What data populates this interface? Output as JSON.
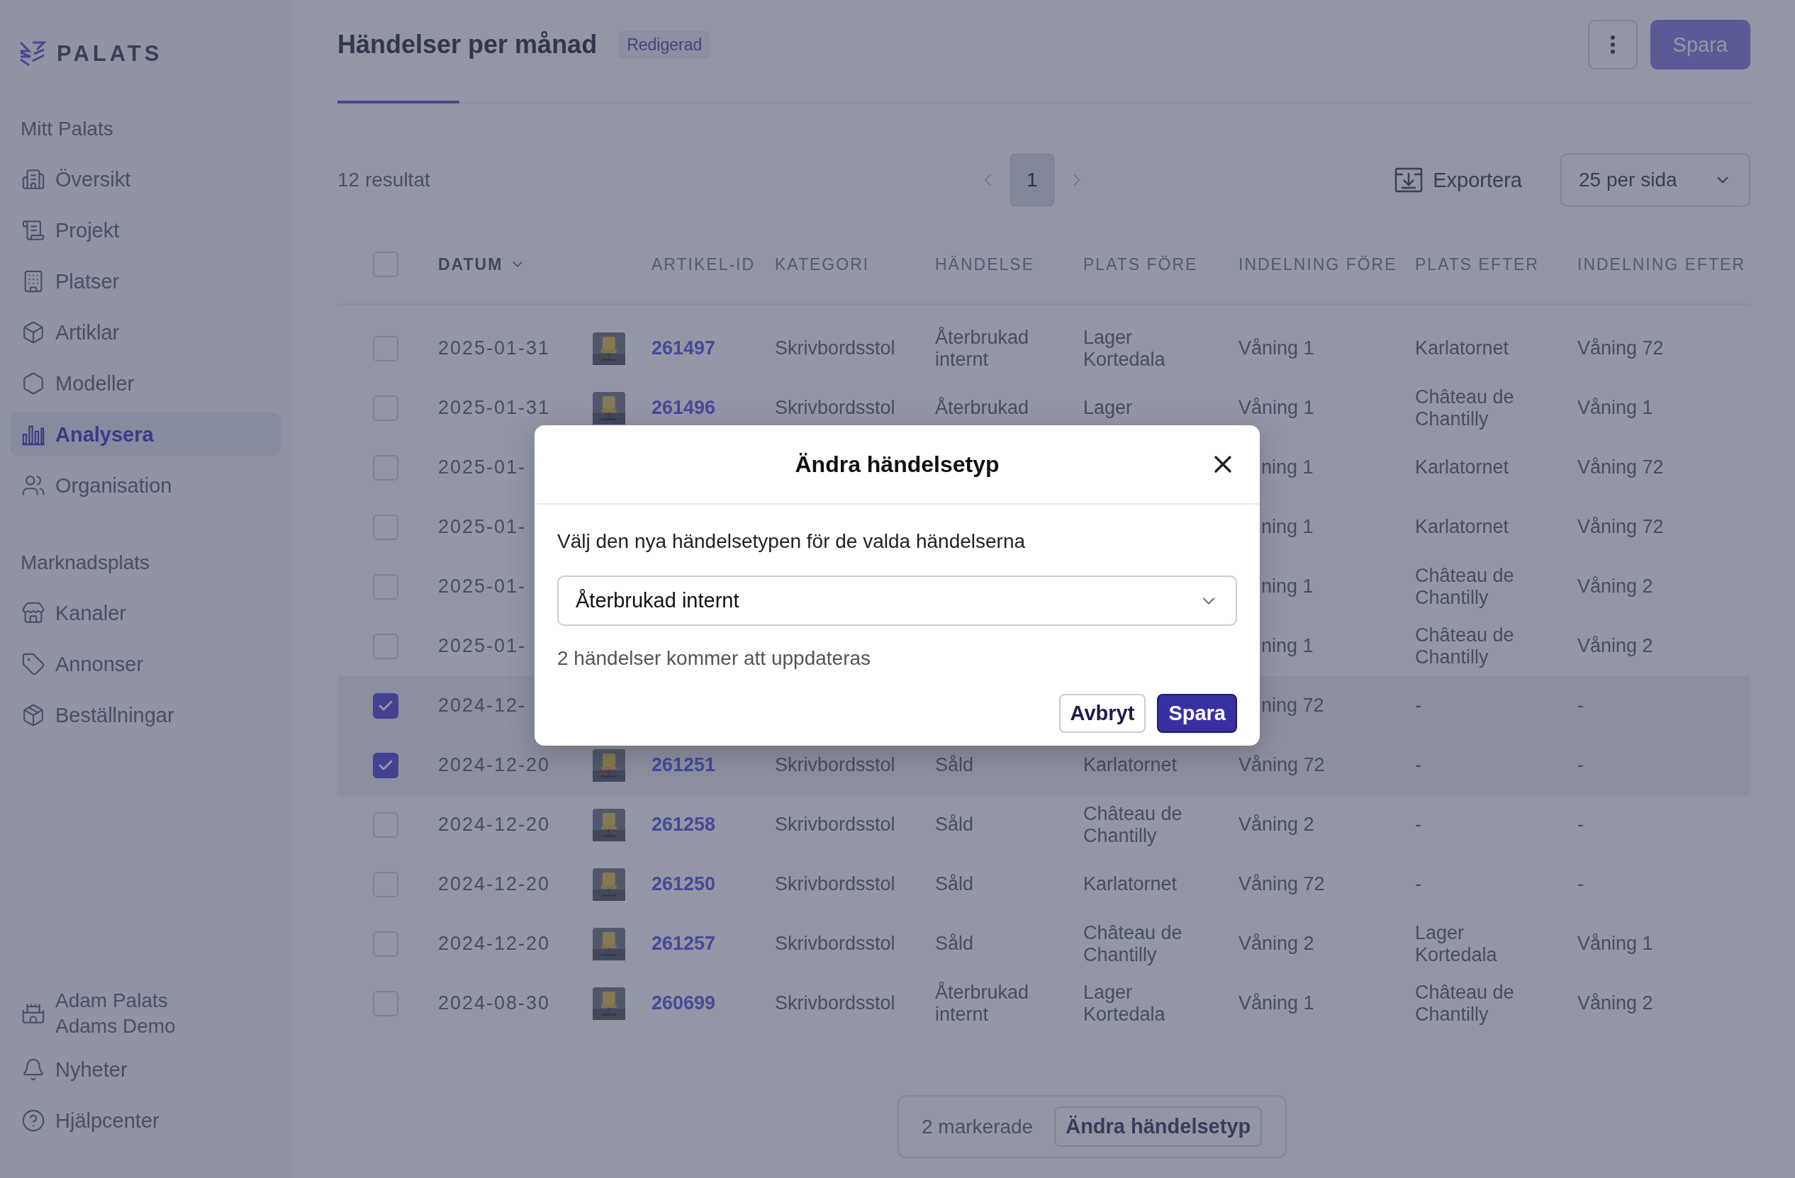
{
  "sidebar": {
    "logo": "PALATS",
    "sections": [
      {
        "title": "Mitt Palats",
        "items": [
          {
            "label": "Översikt",
            "selected": false
          },
          {
            "label": "Projekt",
            "selected": false
          },
          {
            "label": "Platser",
            "selected": false
          },
          {
            "label": "Artiklar",
            "selected": false
          },
          {
            "label": "Modeller",
            "selected": false
          },
          {
            "label": "Analysera",
            "selected": true
          },
          {
            "label": "Organisation",
            "selected": false
          }
        ]
      },
      {
        "title": "Marknadsplats",
        "items": [
          {
            "label": "Kanaler",
            "selected": false
          },
          {
            "label": "Annonser",
            "selected": false
          },
          {
            "label": "Beställningar",
            "selected": false
          }
        ]
      }
    ],
    "account": {
      "name": "Adam Palats",
      "org": "Adams Demo"
    },
    "footer_items": [
      {
        "label": "Nyheter"
      },
      {
        "label": "Hjälpcenter"
      }
    ]
  },
  "header": {
    "title": "Händelser per månad",
    "badge": "Redigerad",
    "save": "Spara"
  },
  "toolbar": {
    "results": "12 resultat",
    "pages": [
      {
        "label": "1",
        "selected": true
      }
    ],
    "export": "Exportera",
    "per_page": "25 per sida"
  },
  "table": {
    "all_checked": false,
    "columns": [
      {
        "label": "DATUM",
        "sorted": true
      },
      {
        "label": "ARTIKEL-ID",
        "sorted": false
      },
      {
        "label": "KATEGORI",
        "sorted": false
      },
      {
        "label": "HÄNDELSE",
        "sorted": false
      },
      {
        "label": "PLATS FÖRE",
        "sorted": false
      },
      {
        "label": "INDELNING FÖRE",
        "sorted": false
      },
      {
        "label": "PLATS EFTER",
        "sorted": false
      },
      {
        "label": "INDELNING EFTER",
        "sorted": false
      }
    ],
    "rows": [
      {
        "selected": false,
        "thumbnail": true,
        "cells": [
          "2025-01-31",
          "261497",
          "Skrivbordsstol",
          "Återbrukad internt",
          "Lager Kortedala",
          "Våning 1",
          "Karlatornet",
          "Våning 72"
        ],
        "cut": false
      },
      {
        "selected": false,
        "thumbnail": true,
        "cells": [
          "2025-01-31",
          "261496",
          "Skrivbordsstol",
          "Återbrukad",
          "Lager",
          "Våning 1",
          "Château de Chantilly",
          "Våning 1"
        ],
        "cut": false
      },
      {
        "selected": false,
        "thumbnail": false,
        "cells": [
          "2025-01-",
          null,
          null,
          null,
          null,
          "ning 1",
          "Karlatornet",
          "Våning 72"
        ],
        "cut": true
      },
      {
        "selected": false,
        "thumbnail": false,
        "cells": [
          "2025-01-",
          null,
          null,
          null,
          null,
          "ning 1",
          "Karlatornet",
          "Våning 72"
        ],
        "cut": true
      },
      {
        "selected": false,
        "thumbnail": false,
        "cells": [
          "2025-01-",
          null,
          null,
          null,
          null,
          "ning 1",
          "Château de Chantilly",
          "Våning 2"
        ],
        "cut": true
      },
      {
        "selected": false,
        "thumbnail": false,
        "cells": [
          "2025-01-",
          null,
          null,
          null,
          null,
          "ning 1",
          "Château de Chantilly",
          "Våning 2"
        ],
        "cut": true
      },
      {
        "selected": true,
        "thumbnail": false,
        "cells": [
          "2024-12-",
          null,
          null,
          null,
          null,
          "ning 72",
          "-",
          "-"
        ],
        "cut": true
      },
      {
        "selected": true,
        "thumbnail": true,
        "cells": [
          "2024-12-20",
          "261251",
          "Skrivbordsstol",
          "Såld",
          "Karlatornet",
          "Våning 72",
          "-",
          "-"
        ],
        "cut": false
      },
      {
        "selected": false,
        "thumbnail": true,
        "cells": [
          "2024-12-20",
          "261258",
          "Skrivbordsstol",
          "Såld",
          "Château de Chantilly",
          "Våning 2",
          "-",
          "-"
        ],
        "cut": false
      },
      {
        "selected": false,
        "thumbnail": true,
        "cells": [
          "2024-12-20",
          "261250",
          "Skrivbordsstol",
          "Såld",
          "Karlatornet",
          "Våning 72",
          "-",
          "-"
        ],
        "cut": false
      },
      {
        "selected": false,
        "thumbnail": true,
        "cells": [
          "2024-12-20",
          "261257",
          "Skrivbordsstol",
          "Såld",
          "Château de Chantilly",
          "Våning 2",
          "Lager Kortedala",
          "Våning 1"
        ],
        "cut": false
      },
      {
        "selected": false,
        "thumbnail": true,
        "cells": [
          "2024-08-30",
          "260699",
          "Skrivbordsstol",
          "Återbrukad internt",
          "Lager Kortedala",
          "Våning 1",
          "Château de Chantilly",
          "Våning 2"
        ],
        "cut": false
      }
    ]
  },
  "selection_bar": {
    "count": "2 markerade",
    "action": "Ändra händelsetyp"
  },
  "modal": {
    "title": "Ändra händelsetyp",
    "prompt": "Välj den nya händelsetypen för de valda händelserna",
    "value": "Återbrukad internt",
    "note": "2 händelser kommer att uppdateras",
    "cancel": "Avbryt",
    "save": "Spara"
  }
}
